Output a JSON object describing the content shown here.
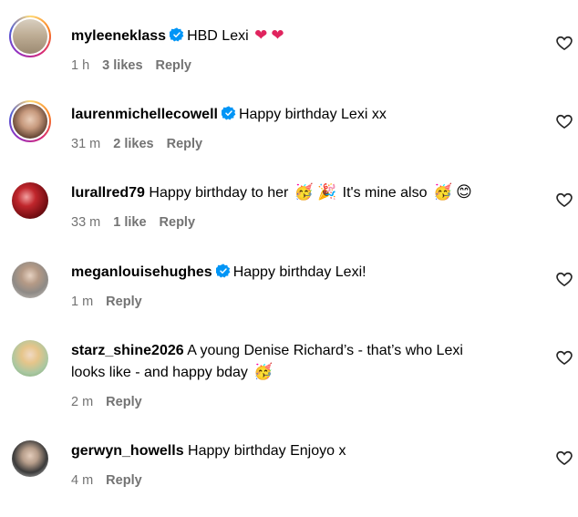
{
  "comments": [
    {
      "username": "myleeneklass",
      "verified": true,
      "text": "HBD Lexi",
      "emojis": [
        "❤",
        "❤"
      ],
      "time": "1 h",
      "likes": "3 likes",
      "reply": "Reply"
    },
    {
      "username": "laurenmichellecowell",
      "verified": true,
      "text": "Happy birthday Lexi xx",
      "time": "31 m",
      "likes": "2 likes",
      "reply": "Reply"
    },
    {
      "username": "lurallred79",
      "verified": false,
      "text_1": "Happy birthday to her",
      "emojis_1": [
        "🥳",
        "🎉"
      ],
      "text_2": "It's mine also",
      "emojis_2": [
        "🥳",
        "😊"
      ],
      "time": "33 m",
      "likes": "1 like",
      "reply": "Reply"
    },
    {
      "username": "meganlouisehughes",
      "verified": true,
      "text": "Happy birthday Lexi!",
      "time": "1 m",
      "reply": "Reply"
    },
    {
      "username": "starz_shine2026",
      "verified": false,
      "text_line1": "A young Denise Richard’s - that’s who Lexi",
      "text_line2": "looks like - and happy bday",
      "emojis": [
        "🥳"
      ],
      "time": "2 m",
      "reply": "Reply"
    },
    {
      "username": "gerwyn_howells",
      "verified": false,
      "text": "Happy birthday Enjoyo x",
      "time": "4 m",
      "reply": "Reply"
    }
  ],
  "icons": {
    "verified": "verified-badge-icon",
    "like": "heart-outline-icon"
  },
  "colors": {
    "verified_blue": "#0095f6",
    "meta_gray": "#737373",
    "heart_red": "#e0245e"
  }
}
